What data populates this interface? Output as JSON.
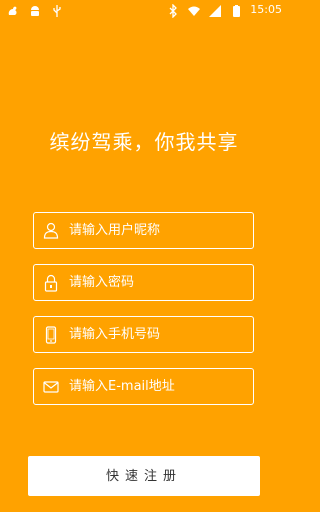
{
  "status_bar": {
    "time": "15:05",
    "left_icons": [
      "squirrel-app-icon",
      "android-icon",
      "usb-icon"
    ],
    "right_icons": [
      "bluetooth-icon",
      "wifi-icon",
      "signal-icon",
      "battery-icon"
    ]
  },
  "slogan": "缤纷驾乘，你我共享",
  "form": {
    "username_placeholder": "请输入用户昵称",
    "password_placeholder": "请输入密码",
    "phone_placeholder": "请输入手机号码",
    "email_placeholder": "请输入E-mail地址"
  },
  "register_button": "快速注册",
  "colors": {
    "background": "#FFA200",
    "field_border": "#FFFFFF",
    "button_bg": "#FFFFFF",
    "button_text": "#333333"
  }
}
